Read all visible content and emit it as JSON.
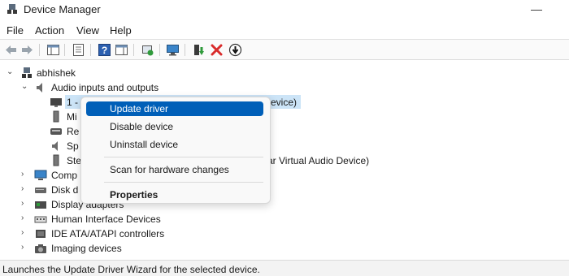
{
  "window": {
    "title": "Device Manager",
    "minimize_glyph": "—"
  },
  "menu": {
    "items": [
      "File",
      "Action",
      "View",
      "Help"
    ]
  },
  "toolbar": {
    "icons": [
      "back-icon",
      "forward-icon",
      "show-hide-console-tree-icon",
      "properties-icon",
      "help-icon",
      "action-pane-icon",
      "scan-hardware-icon",
      "monitor-icon",
      "update-driver-icon",
      "uninstall-device-icon",
      "disable-device-icon"
    ]
  },
  "tree": {
    "root": "abhishek",
    "category_audio": "Audio inputs and outputs",
    "audio_children": [
      "1 -",
      "Mi",
      "Re",
      "Sp",
      "Ste"
    ],
    "selected_suffix": "evice)",
    "stereo_suffix": "ar Virtual Audio Device)",
    "categories": [
      "Comp",
      "Disk d",
      "Display adapters",
      "Human Interface Devices",
      "IDE ATA/ATAPI controllers",
      "Imaging devices"
    ]
  },
  "context_menu": {
    "update_driver": "Update driver",
    "disable_device": "Disable device",
    "uninstall_device": "Uninstall device",
    "scan_hardware": "Scan for hardware changes",
    "properties": "Properties"
  },
  "status": {
    "text": "Launches the Update Driver Wizard for the selected device."
  },
  "colors": {
    "selection": "#cce4f7",
    "menu_highlight": "#005fb8",
    "delete_red": "#d92b2b"
  }
}
